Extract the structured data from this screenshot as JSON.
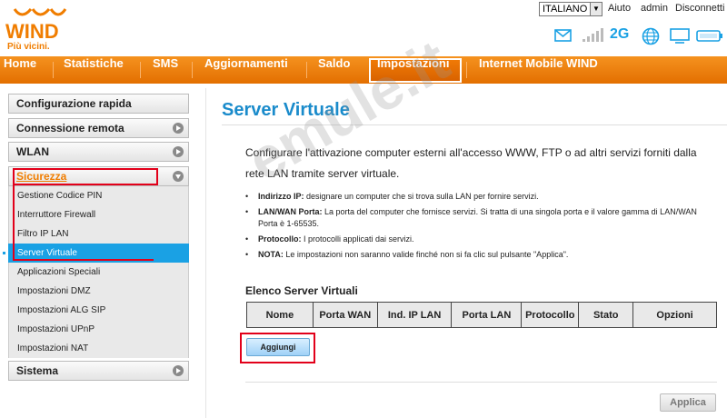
{
  "header": {
    "brand": "WIND",
    "tagline": "Più vicini.",
    "language": "ITALIANO",
    "links": [
      "Aiuto",
      "admin",
      "Disconnetti"
    ],
    "network_type": "2G",
    "icons": [
      "envelope-icon",
      "signal-icon",
      "globe-icon",
      "monitor-icon",
      "battery-icon"
    ]
  },
  "nav": {
    "items": [
      "Home",
      "Statistiche",
      "SMS",
      "Aggiornamenti",
      "Saldo",
      "Impostazioni",
      "Internet Mobile WIND"
    ],
    "active": "Impostazioni"
  },
  "sidebar": {
    "groups": [
      "Configurazione rapida",
      "Connessione remota",
      "WLAN",
      "Sicurezza",
      "Sistema"
    ],
    "security_items": [
      "Gestione Codice PIN",
      "Interruttore Firewall",
      "Filtro IP LAN",
      "Server Virtuale",
      "Applicazioni Speciali",
      "Impostazioni DMZ",
      "Impostazioni ALG SIP",
      "Impostazioni UPnP",
      "Impostazioni NAT"
    ],
    "active_item": "Server Virtuale"
  },
  "main": {
    "title": "Server Virtuale",
    "intro": "Configurare l'attivazione computer esterni all'accesso WWW, FTP o ad altri servizi forniti dalla rete LAN tramite server virtuale.",
    "bullets": [
      {
        "term": "Indirizzo IP:",
        "text": " designare un computer che si trova sulla LAN per fornire servizi."
      },
      {
        "term": "LAN/WAN Porta:",
        "text": " La porta del computer che fornisce servizi. Si tratta di una singola porta e il valore gamma di LAN/WAN Porta è 1-65535."
      },
      {
        "term": "Protocollo:",
        "text": " I protocolli applicati dai servizi."
      },
      {
        "term": "NOTA:",
        "text": " Le impostazioni non saranno valide finché non si fa clic sul pulsante \"Applica\"."
      }
    ],
    "list_title": "Elenco Server Virtuali",
    "columns": [
      "Nome",
      "Porta WAN",
      "Ind. IP LAN",
      "Porta LAN",
      "Protocollo",
      "Stato",
      "Opzioni"
    ],
    "add_button": "Aggiungi",
    "apply_button": "Applica"
  },
  "watermark": "emule.it",
  "colors": {
    "brand_orange": "#f07d00",
    "accent_blue": "#1aa1e4",
    "highlight_red": "#e2001a"
  }
}
